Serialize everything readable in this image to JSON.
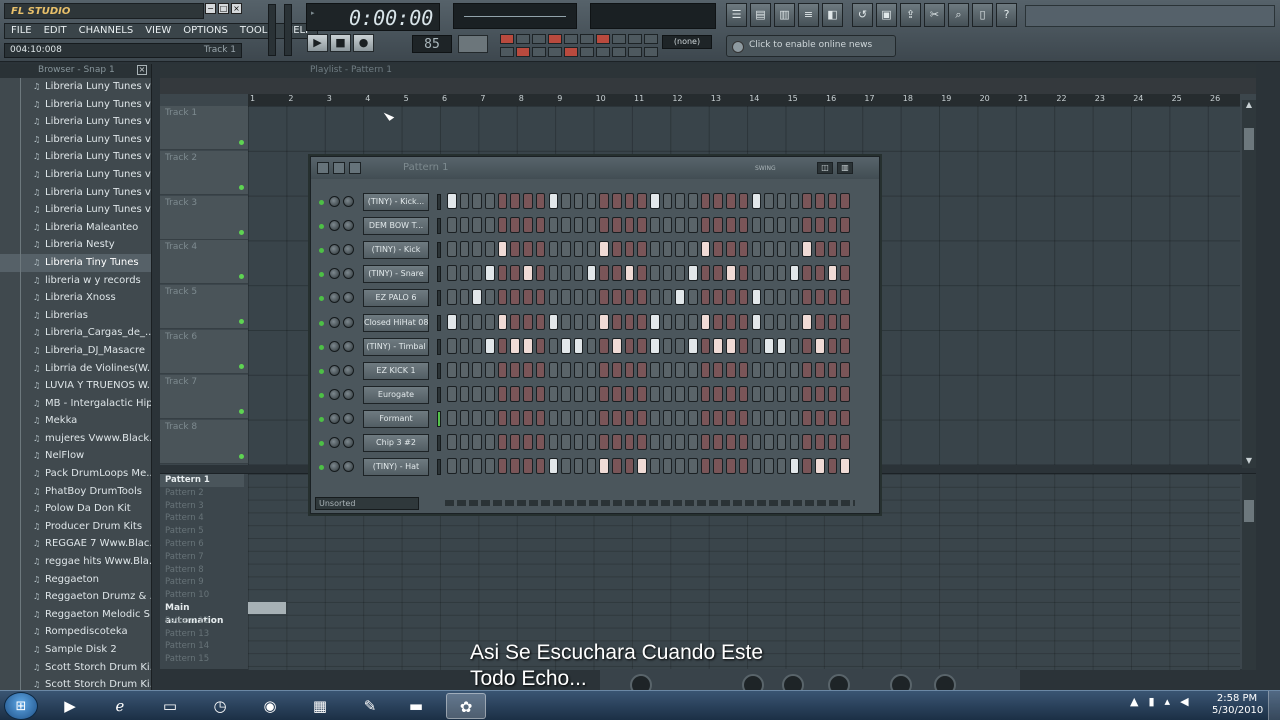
{
  "app": {
    "title": "FL STUDIO",
    "window_buttons": [
      "−",
      "□",
      "×"
    ]
  },
  "menu": [
    "FILE",
    "EDIT",
    "CHANNELS",
    "VIEW",
    "OPTIONS",
    "TOOLS",
    "HELP"
  ],
  "hint_bar": {
    "time": "004:10:008",
    "track": "Track 1"
  },
  "transport": {
    "time": "0:00:00",
    "tempo": "85.000",
    "tempo_display": "85",
    "pattern_selector": "(none)",
    "online_news": "Click to enable online news",
    "play_icon": "play-icon",
    "stop_icon": "stop-icon",
    "record_icon": "record-icon"
  },
  "toolbar_icons": [
    "playlist-icon",
    "piano-roll-icon",
    "step-sequencer-icon",
    "mixer-icon",
    "browser-icon",
    "undo-icon",
    "save-icon",
    "export-icon",
    "cut-icon",
    "search-icon",
    "help-doc-icon",
    "help-icon"
  ],
  "browser": {
    "title": "Browser - Snap 1",
    "selected_index": 10,
    "items": [
      "Libreria Luny Tunes v...",
      "Libreria Luny Tunes v...",
      "Libreria Luny Tunes v...",
      "Libreria Luny Tunes v...",
      "Libreria Luny Tunes v...",
      "Libreria Luny Tunes v...",
      "Libreria Luny Tunes v...",
      "Libreria Luny Tunes v...",
      "Libreria Maleanteo",
      "Libreria Nesty",
      "Libreria Tiny Tunes",
      "libreria w y records",
      "Libreria Xnoss",
      "Librerias",
      "Libreria_Cargas_de_...",
      "Libreria_DJ_Masacre",
      "Librria de Violines(W...",
      "LUVIA Y TRUENOS W...",
      "MB - Intergalactic Hip...",
      "Mekka",
      "mujeres Vwww.Black...",
      "NelFlow",
      "Pack DrumLoops Me...",
      "PhatBoy DrumTools",
      "Polow Da Don Kit",
      "Producer Drum Kits",
      "REGGAE 7 Www.Blac...",
      "reggae hits Www.Bla...",
      "Reggaeton",
      "Reggaeton Drumz & ...",
      "Reggaeton Melodic S...",
      "Rompediscoteka",
      "Sample Disk 2",
      "Scott Storch Drum Ki...",
      "Scott Storch Drum Ki..."
    ]
  },
  "playlist": {
    "title": "Playlist - Pattern 1",
    "bars": [
      "1",
      "2",
      "3",
      "4",
      "5",
      "6",
      "7",
      "8",
      "9",
      "10",
      "11",
      "12",
      "13",
      "14",
      "15",
      "16",
      "17",
      "18",
      "19",
      "20",
      "21",
      "22",
      "23",
      "24",
      "25",
      "26"
    ],
    "tracks": [
      "Track 1",
      "Track 2",
      "Track 3",
      "Track 4",
      "Track 5",
      "Track 6",
      "Track 7",
      "Track 8"
    ]
  },
  "patterns": [
    "Pattern 1",
    "Pattern 2",
    "Pattern 3",
    "Pattern 4",
    "Pattern 5",
    "Pattern 6",
    "Pattern 7",
    "Pattern 8",
    "Pattern 9",
    "Pattern 10",
    "Main automation",
    "Pattern 12",
    "Pattern 13",
    "Pattern 14",
    "Pattern 15"
  ],
  "step_sequencer": {
    "title": "Pattern 1",
    "swing_label": "SWING",
    "footer": "Unsorted",
    "channels": [
      {
        "name": "(TINY) - Kick...",
        "steps": [
          0,
          8,
          16,
          24
        ]
      },
      {
        "name": "DEM BOW T...",
        "steps": []
      },
      {
        "name": "(TINY) - Kick",
        "steps": [
          4,
          12,
          20,
          28
        ]
      },
      {
        "name": "(TINY) - Snare",
        "steps": [
          3,
          6,
          11,
          14,
          19,
          22,
          27,
          30
        ]
      },
      {
        "name": "EZ PALO 6",
        "steps": [
          2,
          18,
          24
        ]
      },
      {
        "name": "Closed HiHat 08",
        "steps": [
          0,
          4,
          8,
          12,
          16,
          20,
          24,
          28
        ]
      },
      {
        "name": "(TINY) - Timbal",
        "steps": [
          3,
          5,
          6,
          9,
          10,
          13,
          16,
          19,
          21,
          22,
          25,
          26,
          29
        ]
      },
      {
        "name": "EZ KICK 1",
        "steps": []
      },
      {
        "name": "Eurogate",
        "steps": []
      },
      {
        "name": "Formant",
        "steps": []
      },
      {
        "name": "Chip 3 #2",
        "steps": []
      },
      {
        "name": "(TINY) - Hat",
        "steps": [
          8,
          12,
          15,
          27,
          29,
          31
        ]
      }
    ]
  },
  "subtitle": [
    "Asi Se Escuchara Cuando Este",
    "Todo Echo..."
  ],
  "taskbar": {
    "start_icon": "windows-start-icon",
    "apps": [
      "media-player-icon",
      "internet-explorer-icon",
      "file-explorer-icon",
      "clock-app-icon",
      "firefox-icon",
      "spreadsheet-icon",
      "pin-icon",
      "folder-icon",
      "fl-studio-icon"
    ],
    "clock_time": "2:58 PM",
    "clock_date": "5/30/2010"
  }
}
